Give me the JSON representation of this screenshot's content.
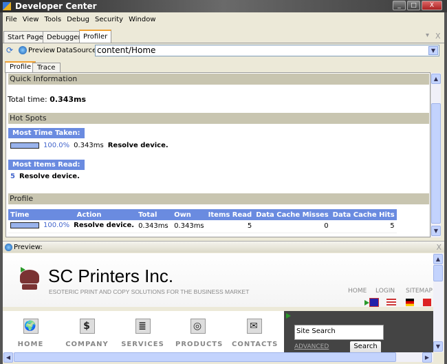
{
  "window": {
    "title": "Developer Center",
    "minimize": "_",
    "maximize": "□",
    "close": "X"
  },
  "menu": [
    "File",
    "View",
    "Tools",
    "Debug",
    "Security",
    "Window"
  ],
  "tabs": [
    {
      "label": "Start Page"
    },
    {
      "label": "Debugger"
    },
    {
      "label": "Profiler",
      "active": true
    }
  ],
  "tab_controls": {
    "dropdown": "▾",
    "close": "X"
  },
  "toolbar": {
    "preview_label": "Preview",
    "datasource_label": "DataSource:",
    "datasource_value": "content/Home"
  },
  "inner_tabs": [
    {
      "label": "Profile",
      "active": true
    },
    {
      "label": "Trace"
    }
  ],
  "quick_info": {
    "header": "Quick Information",
    "total_label": "Total time:",
    "total_value": "0.343ms"
  },
  "hot_spots": {
    "header": "Hot Spots",
    "most_time": {
      "label": "Most Time Taken:",
      "percent": "100.0%",
      "time": "0.343ms",
      "action": "Resolve device."
    },
    "most_items": {
      "label": "Most Items Read:",
      "count": "5",
      "action": "Resolve device."
    }
  },
  "profile": {
    "header": "Profile",
    "columns": [
      "Time",
      "Action",
      "Total",
      "Own",
      "Items Read",
      "Data Cache Misses",
      "Data Cache Hits"
    ],
    "rows": [
      {
        "percent": "100.0%",
        "action": "Resolve device.",
        "total": "0.343ms",
        "own": "0.343ms",
        "items_read": "5",
        "misses": "0",
        "hits": "5"
      }
    ]
  },
  "preview": {
    "label": "Preview:",
    "close": "X",
    "site": {
      "title": "SC Printers Inc.",
      "tagline": "ESOTERIC PRINT AND COPY SOLUTIONS FOR THE BUSINESS MARKET",
      "top_links": [
        "HOME",
        "LOGIN",
        "SITEMAP"
      ],
      "nav": [
        {
          "label": "HOME",
          "icon": "globe-icon",
          "glyph": "🌍"
        },
        {
          "label": "COMPANY",
          "icon": "dollar-doc-icon",
          "glyph": "$"
        },
        {
          "label": "SERVICES",
          "icon": "document-icon",
          "glyph": "≣"
        },
        {
          "label": "PRODUCTS",
          "icon": "cd-icon",
          "glyph": "◎"
        },
        {
          "label": "CONTACTS",
          "icon": "envelope-icon",
          "glyph": "✉"
        }
      ],
      "search": {
        "value": "Site Search",
        "advanced": "ADVANCED",
        "button": "Search"
      }
    }
  },
  "colors": {
    "accent": "#6a8be0",
    "section": "#c8c5b0",
    "tab_highlight": "#f0a030",
    "logo": "#7a3333"
  }
}
